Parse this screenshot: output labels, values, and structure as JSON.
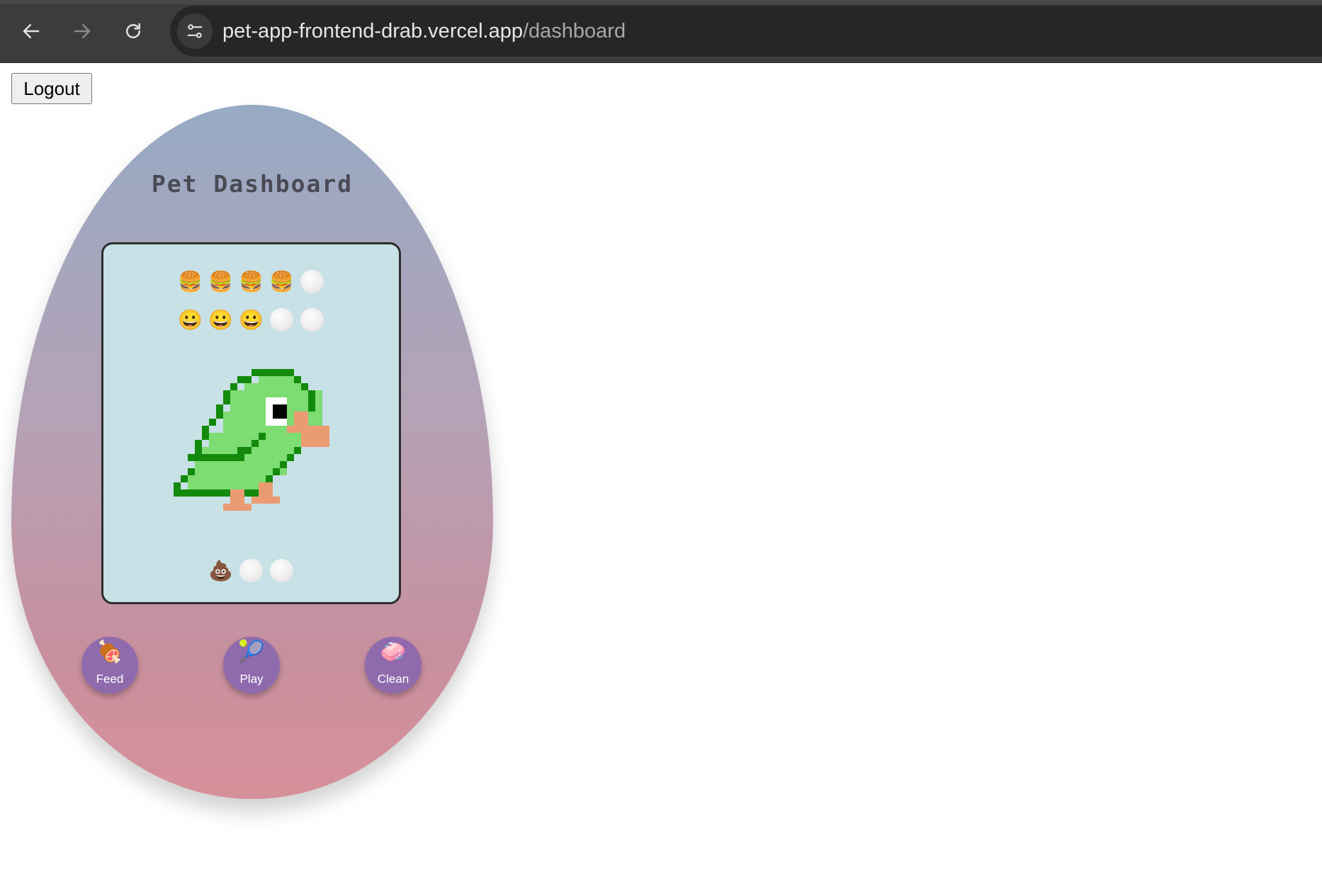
{
  "browser": {
    "url_host": "pet-app-frontend-drab.vercel.app",
    "url_path": "/dashboard"
  },
  "page": {
    "logout_label": "Logout",
    "title": "Pet Dashboard"
  },
  "stats": {
    "hunger": {
      "icon": "🍔",
      "filled": 4,
      "max": 5
    },
    "happiness": {
      "icon": "😀",
      "filled": 3,
      "max": 5
    },
    "waste": {
      "icon": "💩",
      "filled": 1,
      "max": 3
    }
  },
  "pet": {
    "sprite": "green-parrot-icon"
  },
  "actions": {
    "feed": {
      "label": "Feed",
      "icon": "🍖"
    },
    "play": {
      "label": "Play",
      "icon": "🎾"
    },
    "clean": {
      "label": "Clean",
      "icon": "🧼"
    }
  },
  "colors": {
    "egg_top": "#97aac4",
    "egg_bottom": "#d6909a",
    "screen_bg": "#c7e1e6",
    "button_bg": "#8f6aad",
    "parrot_body": "#7ddc72",
    "parrot_outline": "#138a0c",
    "parrot_beak": "#eb9b72"
  }
}
